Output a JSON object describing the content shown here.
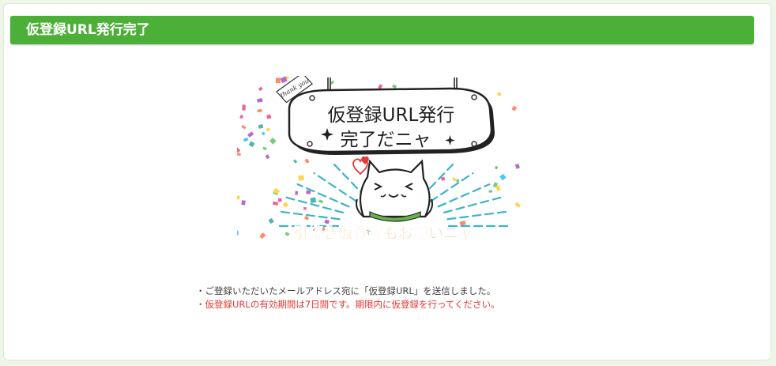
{
  "header": {
    "title": "仮登録URL発行完了"
  },
  "illustration": {
    "thank_you": "thank you",
    "sign_line1": "仮登録URL発行",
    "sign_line2": "完了だニャ",
    "footer_text": "引続き仮登録もお願いニャ"
  },
  "notes": [
    "・ご登録いただいたメールアドレス宛に「仮登録URL」を送信しました。",
    "・仮登録URLの有効期間は7日間です。期限内に仮登録を行ってください。"
  ],
  "colors": {
    "header_bg": "#4caf38",
    "accent_orange": "#f08c24",
    "warning_red": "#e53935"
  }
}
